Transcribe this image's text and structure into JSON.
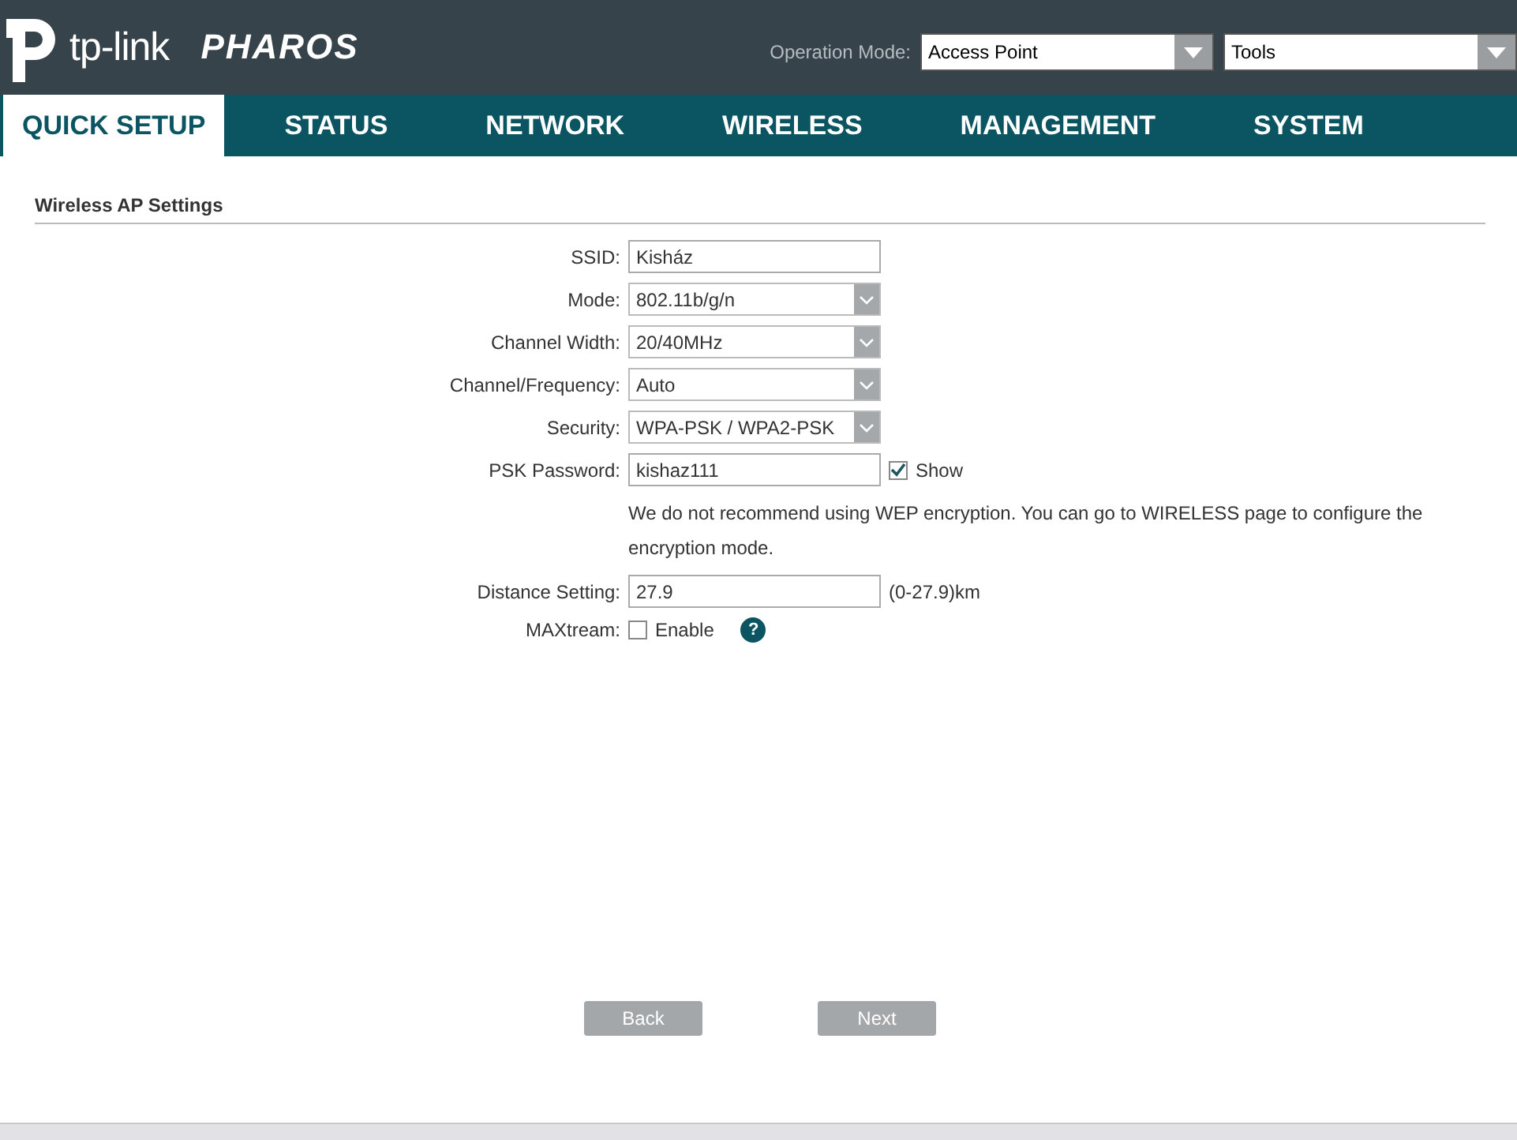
{
  "header": {
    "brand": "tp-link",
    "product": "PHAROS",
    "operation_mode": {
      "label": "Operation Mode:",
      "value": "Access Point"
    },
    "tools": {
      "value": "Tools"
    }
  },
  "tabs": [
    {
      "label": "QUICK SETUP",
      "selected": true
    },
    {
      "label": "STATUS",
      "selected": false
    },
    {
      "label": "NETWORK",
      "selected": false
    },
    {
      "label": "WIRELESS",
      "selected": false
    },
    {
      "label": "MANAGEMENT",
      "selected": false
    },
    {
      "label": "SYSTEM",
      "selected": false
    }
  ],
  "section_title": "Wireless AP Settings",
  "fields": [
    {
      "kind": "text",
      "label": "SSID:",
      "value": "Kisház"
    },
    {
      "kind": "select",
      "label": "Mode:",
      "value": "802.11b/g/n"
    },
    {
      "kind": "select",
      "label": "Channel Width:",
      "value": "20/40MHz"
    },
    {
      "kind": "select",
      "label": "Channel/Frequency:",
      "value": "Auto"
    },
    {
      "kind": "select",
      "label": "Security:",
      "value": "WPA-PSK / WPA2-PSK"
    },
    {
      "kind": "password",
      "label": "PSK Password:",
      "value": "kishaz111",
      "option": "Show",
      "checked": true
    },
    {
      "kind": "note",
      "text": "We do not recommend using WEP encryption. You can go to WIRELESS page to configure the encryption mode."
    },
    {
      "kind": "text",
      "label": "Distance Setting:",
      "value": "27.9",
      "suffix": "(0-27.9)km"
    },
    {
      "kind": "checkbox",
      "label": "MAXtream:",
      "option": "Enable",
      "checked": false,
      "help": "?"
    }
  ],
  "buttons": [
    "Back",
    "Next"
  ]
}
